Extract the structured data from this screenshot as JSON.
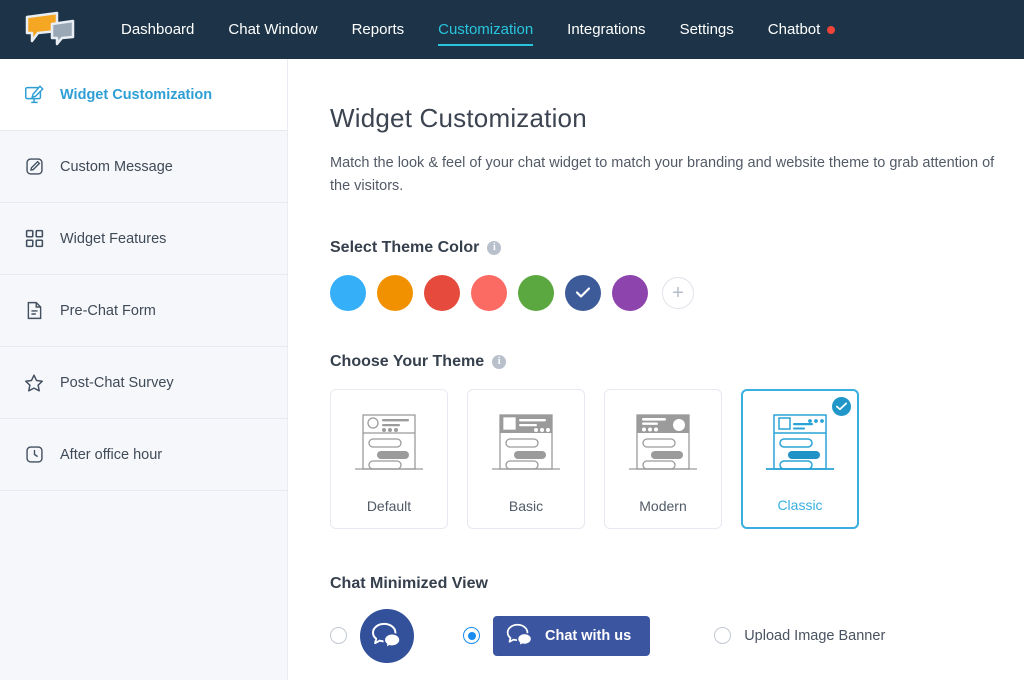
{
  "topnav": {
    "logo_name": "chat-bubbles-logo",
    "items": [
      {
        "label": "Dashboard",
        "active": false,
        "dot": false
      },
      {
        "label": "Chat Window",
        "active": false,
        "dot": false
      },
      {
        "label": "Reports",
        "active": false,
        "dot": false
      },
      {
        "label": "Customization",
        "active": true,
        "dot": false
      },
      {
        "label": "Integrations",
        "active": false,
        "dot": false
      },
      {
        "label": "Settings",
        "active": false,
        "dot": false
      },
      {
        "label": "Chatbot",
        "active": false,
        "dot": true
      }
    ],
    "bg_color": "#1d3448",
    "active_color": "#29c5dd",
    "dot_color": "#f04438"
  },
  "sidebar": {
    "items": [
      {
        "label": "Widget Customization",
        "icon": "monitor-pen-icon",
        "active": true
      },
      {
        "label": "Custom Message",
        "icon": "edit-square-icon",
        "active": false
      },
      {
        "label": "Widget Features",
        "icon": "grid-squares-icon",
        "active": false
      },
      {
        "label": "Pre-Chat Form",
        "icon": "document-icon",
        "active": false
      },
      {
        "label": "Post-Chat Survey",
        "icon": "star-icon",
        "active": false
      },
      {
        "label": "After office hour",
        "icon": "clock-icon",
        "active": false
      }
    ]
  },
  "main": {
    "title": "Widget Customization",
    "description": "Match the look & feel of your chat widget to match your branding and website theme to grab attention of the visitors.",
    "theme_color": {
      "title": "Select Theme Color",
      "info_icon": "info-icon",
      "add_label": "+",
      "swatches": [
        {
          "name": "blue",
          "color": "#35aff7",
          "selected": false
        },
        {
          "name": "orange",
          "color": "#f29100",
          "selected": false
        },
        {
          "name": "red",
          "color": "#e54a3d",
          "selected": false
        },
        {
          "name": "coral",
          "color": "#fb6a63",
          "selected": false
        },
        {
          "name": "green",
          "color": "#5aa83f",
          "selected": false
        },
        {
          "name": "navy",
          "color": "#3c5b98",
          "selected": true
        },
        {
          "name": "purple",
          "color": "#8e44ad",
          "selected": false
        }
      ]
    },
    "choose_theme": {
      "title": "Choose Your Theme",
      "info_icon": "info-icon",
      "selected_color": "#38afe0",
      "cards": [
        {
          "label": "Default",
          "art": "default",
          "selected": false
        },
        {
          "label": "Basic",
          "art": "basic",
          "selected": false
        },
        {
          "label": "Modern",
          "art": "modern",
          "selected": false
        },
        {
          "label": "Classic",
          "art": "classic",
          "selected": true
        }
      ]
    },
    "minimized_view": {
      "title": "Chat Minimized View",
      "options": [
        {
          "name": "bubble-icon-option",
          "label": "",
          "selected": false
        },
        {
          "name": "chat-with-us-button-option",
          "label": "Chat with us",
          "selected": true
        },
        {
          "name": "upload-image-banner-option",
          "label": "Upload Image Banner",
          "selected": false
        }
      ],
      "button_color": "#3b55a0",
      "bubble_color": "#33519b"
    }
  }
}
